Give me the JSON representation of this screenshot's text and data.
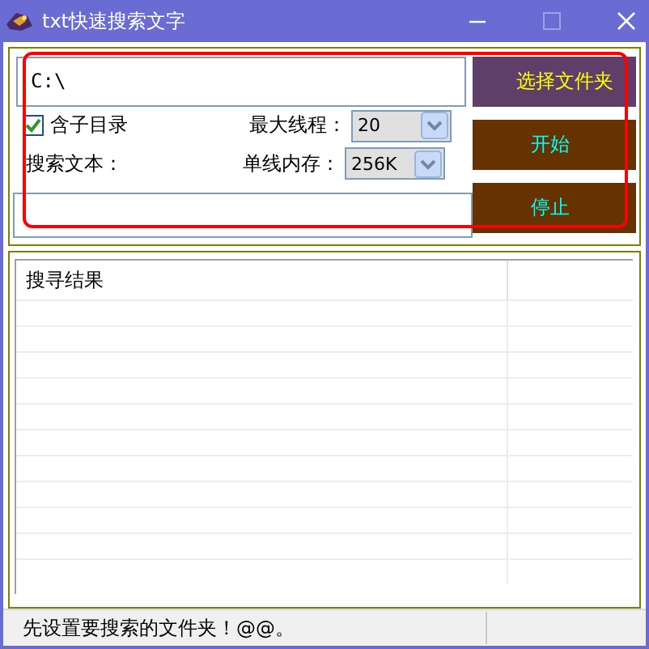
{
  "window": {
    "title": "txt快速搜索文字"
  },
  "path_field": {
    "value": "C:\\"
  },
  "subdirs": {
    "label": "含子目录",
    "checked": true
  },
  "max_threads": {
    "label": "最大线程：",
    "value": "20"
  },
  "search_text": {
    "label": "搜索文本："
  },
  "memory": {
    "label": "单线内存：",
    "value": "256K"
  },
  "buttons": [
    {
      "label": "选择文件夹",
      "kind": "select"
    },
    {
      "label": "开始",
      "kind": "start"
    },
    {
      "label": "停止",
      "kind": "stop"
    }
  ],
  "results": {
    "columns": [
      "搜寻结果"
    ]
  },
  "status_bar": {
    "text": "先设置要搜索的文件夹！@@。"
  }
}
